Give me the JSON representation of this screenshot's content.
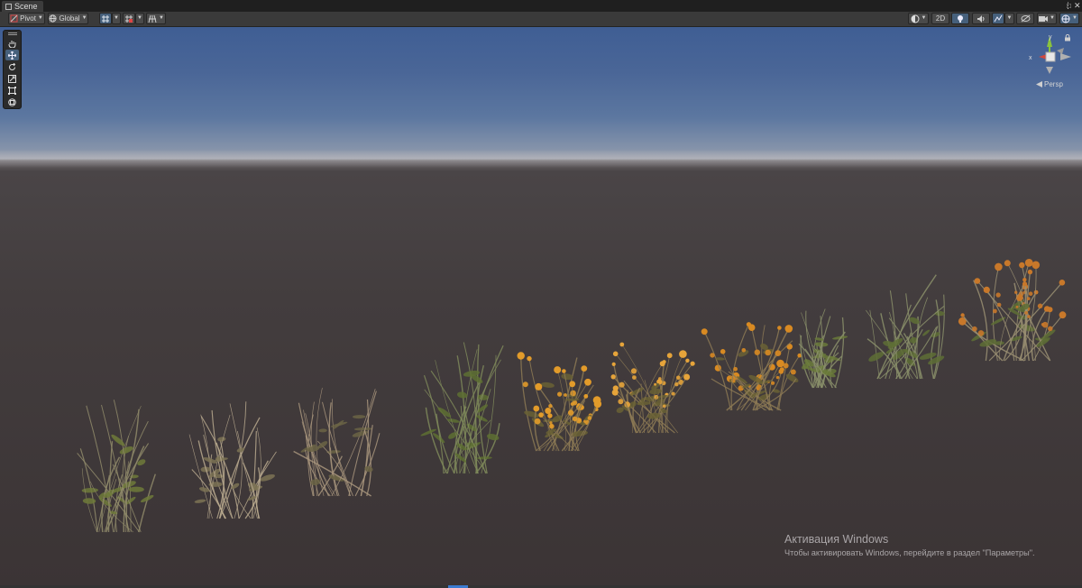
{
  "tab": {
    "title": "Scene",
    "icon": "scene-icon"
  },
  "window_controls": {
    "menu": "⋮",
    "maximize": "□",
    "close": "✕"
  },
  "toolbar": {
    "pivot_label": "Pivot",
    "global_label": "Global",
    "mode_2d_label": "2D",
    "icons": [
      "pivot-icon",
      "global-icon",
      "grid-snap-icon",
      "snap-increment-icon",
      "grid-icon",
      "draw-mode-icon",
      "lighting-icon",
      "audio-icon",
      "effects-icon",
      "hidden-objects-icon",
      "camera-icon",
      "gizmos-icon"
    ]
  },
  "tools": [
    "view-tool-icon",
    "move-tool-icon",
    "rotate-tool-icon",
    "scale-tool-icon",
    "rect-tool-icon",
    "transform-tool-icon"
  ],
  "gizmo": {
    "axis_y": "y",
    "axis_x": "x",
    "projection_label": "Persp"
  },
  "watermark": {
    "title": "Активация Windows",
    "subtitle": "Чтобы активировать Windows, перейдите в раздел \"Параметры\"."
  },
  "colors": {
    "accent": "#46607c",
    "sky_top": "#3f5e94",
    "horizon": "#a2a5ad",
    "ground": "#433d3e",
    "axis_x": "#d0473d",
    "axis_y": "#8ac23d",
    "taskbar_mark": "#3b7bd1"
  }
}
